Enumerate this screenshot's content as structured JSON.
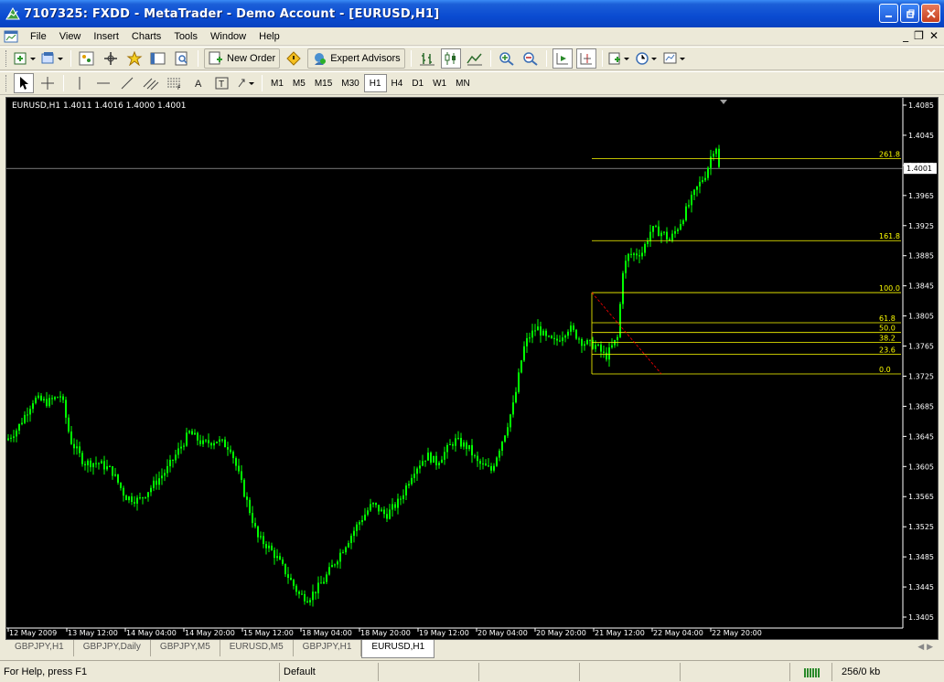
{
  "window": {
    "title": "7107325: FXDD - MetaTrader - Demo Account - [EURUSD,H1]"
  },
  "menu": {
    "items": [
      "File",
      "View",
      "Insert",
      "Charts",
      "Tools",
      "Window",
      "Help"
    ]
  },
  "toolbar": {
    "new_order_label": "New Order",
    "expert_advisors_label": "Expert Advisors"
  },
  "timeframes": [
    "M1",
    "M5",
    "M15",
    "M30",
    "H1",
    "H4",
    "D1",
    "W1",
    "MN"
  ],
  "active_timeframe": "H1",
  "chart": {
    "info": "EURUSD,H1  1.4011 1.4016 1.4000 1.4001",
    "current_price": "1.4001",
    "price_labels": [
      "1.4085",
      "1.4045",
      "1.4005",
      "1.3965",
      "1.3925",
      "1.3885",
      "1.3845",
      "1.3805",
      "1.3765",
      "1.3725",
      "1.3685",
      "1.3645",
      "1.3605",
      "1.3565",
      "1.3525",
      "1.3485",
      "1.3445",
      "1.3405"
    ],
    "time_labels": [
      "12 May 2009",
      "13 May 12:00",
      "14 May 04:00",
      "14 May 20:00",
      "15 May 12:00",
      "18 May 04:00",
      "18 May 20:00",
      "19 May 12:00",
      "20 May 04:00",
      "20 May 20:00",
      "21 May 12:00",
      "22 May 04:00",
      "22 May 20:00"
    ],
    "fib_levels": [
      {
        "label": "261.8",
        "price": 1.4014
      },
      {
        "label": "161.8",
        "price": 1.3905
      },
      {
        "label": "100.0",
        "price": 1.3836
      },
      {
        "label": "61.8",
        "price": 1.3796
      },
      {
        "label": "50.0",
        "price": 1.3783
      },
      {
        "label": "38.2",
        "price": 1.377
      },
      {
        "label": "23.6",
        "price": 1.3754
      },
      {
        "label": "0.0",
        "price": 1.3728
      }
    ],
    "colors": {
      "candle": "#00ff00",
      "fib": "#ffff00",
      "fib_trend": "#ff0000",
      "background": "#000000",
      "grid_text": "#ffffff"
    }
  },
  "tabs": [
    "GBPJPY,H1",
    "GBPJPY,Daily",
    "GBPJPY,M5",
    "EURUSD,M5",
    "GBPJPY,H1",
    "EURUSD,H1"
  ],
  "active_tab": "EURUSD,H1",
  "status": {
    "help": "For Help, press F1",
    "profile": "Default",
    "traffic": "256/0 kb"
  }
}
